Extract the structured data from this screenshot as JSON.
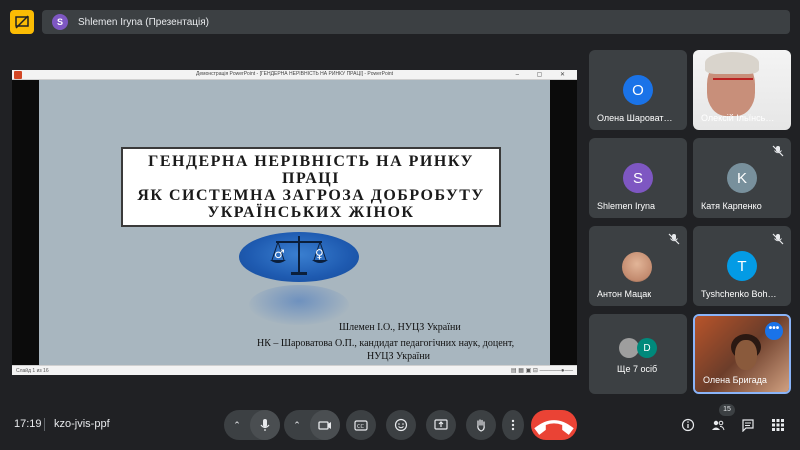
{
  "presenter": {
    "initial": "S",
    "label": "Shlemen Iryna (Презентація)"
  },
  "slideshow": {
    "window_title": "Демонстрація PowerPoint - [ГЕНДЕРНА НЕРІВНІСТЬ НА РИНКУ ПРАЦІ] - PowerPoint",
    "title_lines": [
      "ГЕНДЕРНА НЕРІВНІСТЬ НА РИНКУ",
      "ПРАЦІ",
      "ЯК СИСТЕМНА ЗАГРОЗА ДОБРОБУТУ",
      "УКРАЇНСЬКИХ ЖІНОК"
    ],
    "author1": "Шлемен І.О., НУЦЗ України",
    "author2": "НК – Шароватова О.П., кандидат педагогічних наук, доцент,",
    "author3": "НУЦЗ України",
    "status": "Слайд 1 из 16"
  },
  "participants": [
    {
      "name": "Олена Шароват…",
      "initial": "O",
      "color": "#1a73e8"
    },
    {
      "name": "Олексій Ільїнсь…",
      "photo": true
    },
    {
      "name": "Shlemen Iryna",
      "initial": "S",
      "color": "#7e57c2"
    },
    {
      "name": "Катя Карпенко",
      "initial": "K",
      "color": "#78909c",
      "muted": true
    },
    {
      "name": "Антон Мацак",
      "photo": true,
      "muted": true
    },
    {
      "name": "Tyshchenko Boh…",
      "initial": "T",
      "color": "#039be5",
      "muted": true
    },
    {
      "name": "Ще 7 осіб",
      "initial": "D",
      "color": "#00897b"
    },
    {
      "name": "Олена Бригада",
      "photo": true,
      "speaking": true
    }
  ],
  "bottom_bar": {
    "time": "17:19",
    "meeting_code": "kzo-jvis-ppf",
    "participant_count": "15",
    "end_call_color": "#ea4335"
  },
  "icons": [
    "present-icon",
    "mic-icon",
    "camera-icon",
    "captions-icon",
    "emoji-icon",
    "present-screen-icon",
    "raise-hand-icon",
    "more-options-icon",
    "end-call-icon",
    "info-icon",
    "people-icon",
    "chat-icon",
    "activities-icon"
  ]
}
